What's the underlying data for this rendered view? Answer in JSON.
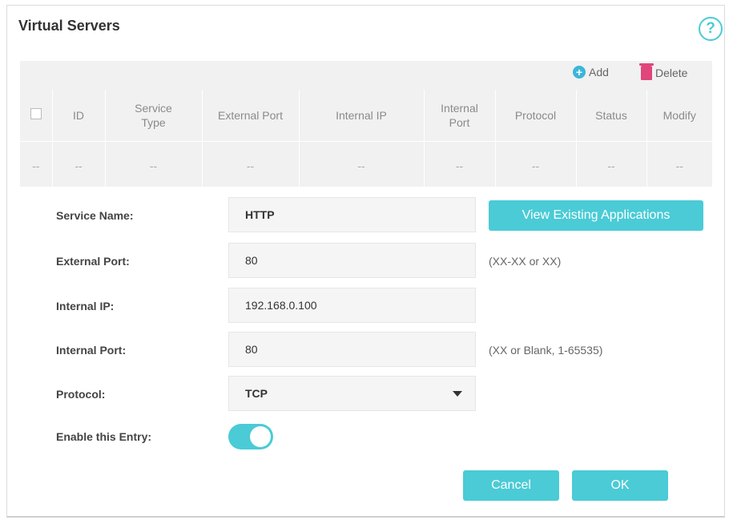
{
  "page": {
    "title": "Virtual Servers",
    "help_icon": "question-circle-icon",
    "help_glyph": "?"
  },
  "toolbar": {
    "add_label": "Add",
    "delete_label": "Delete",
    "add_glyph": "+"
  },
  "table": {
    "columns": [
      "",
      "ID",
      "Service\nType",
      "External Port",
      "Internal IP",
      "Internal\nPort",
      "Protocol",
      "Status",
      "Modify"
    ],
    "rows": [
      [
        "--",
        "--",
        "--",
        "--",
        "--",
        "--",
        "--",
        "--",
        "--"
      ]
    ]
  },
  "form": {
    "service_name": {
      "label": "Service Name:",
      "value": "HTTP"
    },
    "view_apps_label": "View Existing Applications",
    "external_port": {
      "label": "External Port:",
      "value": "80",
      "hint": "(XX-XX or XX)"
    },
    "internal_ip": {
      "label": "Internal IP:",
      "value": "192.168.0.100"
    },
    "internal_port": {
      "label": "Internal Port:",
      "value": "80",
      "hint": "(XX or Blank, 1-65535)"
    },
    "protocol": {
      "label": "Protocol:",
      "value": "TCP"
    },
    "enable": {
      "label": "Enable this Entry:",
      "on": true
    },
    "cancel_label": "Cancel",
    "ok_label": "OK"
  },
  "colors": {
    "accent": "#4acbd6",
    "delete": "#e0457b",
    "add": "#3bb6d9"
  }
}
